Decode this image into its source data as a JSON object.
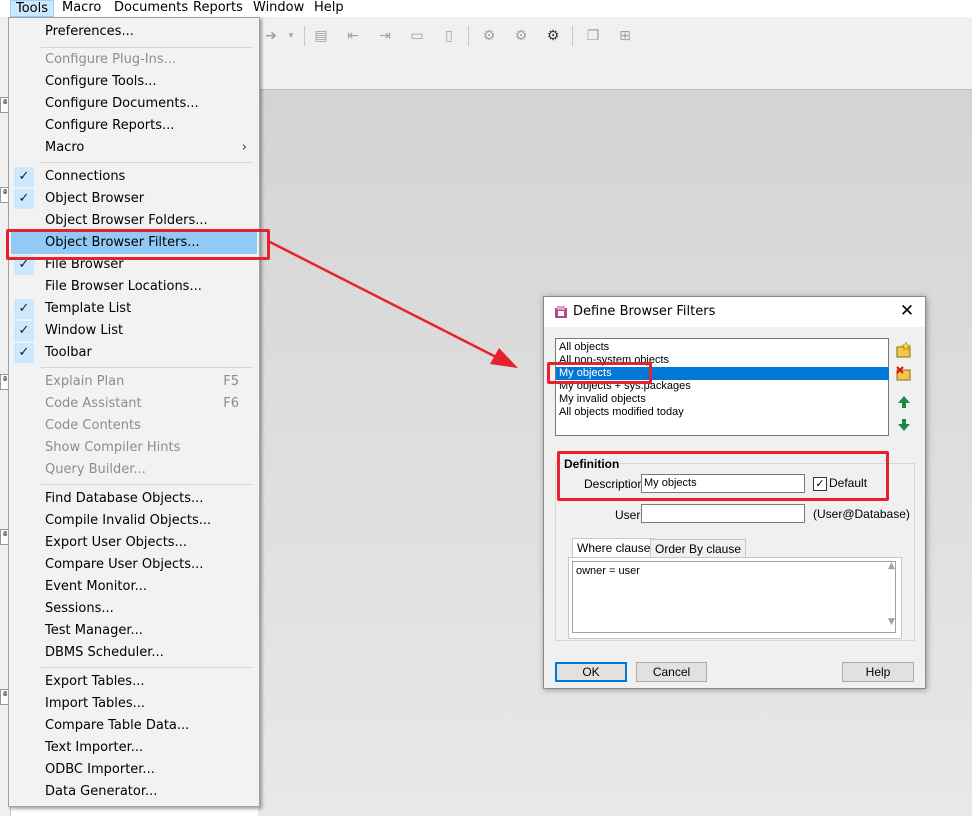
{
  "menubar": {
    "items": [
      {
        "label": "Tools",
        "active": true
      },
      {
        "label": "Macro"
      },
      {
        "label": "Documents"
      },
      {
        "label": "Reports"
      },
      {
        "label": "Window"
      },
      {
        "label": "Help"
      }
    ]
  },
  "background": {
    "strip_marks": [
      "ª",
      "ª",
      "ª",
      "ª",
      "ª"
    ]
  },
  "tools_menu": {
    "preferences": "Preferences...",
    "configure_plugins": "Configure Plug-Ins...",
    "configure_tools": "Configure Tools...",
    "configure_documents": "Configure Documents...",
    "configure_reports": "Configure Reports...",
    "macro": "Macro",
    "macro_arrow": "›",
    "connections": "Connections",
    "object_browser": "Object Browser",
    "object_browser_folders": "Object Browser Folders...",
    "object_browser_filters": "Object Browser Filters...",
    "file_browser": "File Browser",
    "file_browser_locations": "File Browser Locations...",
    "template_list": "Template List",
    "window_list": "Window List",
    "toolbar": "Toolbar",
    "explain_plan": "Explain Plan",
    "explain_plan_shortcut": "F5",
    "code_assistant": "Code Assistant",
    "code_assistant_shortcut": "F6",
    "code_contents": "Code Contents",
    "show_compiler_hints": "Show Compiler Hints",
    "query_builder": "Query Builder...",
    "find_database_objects": "Find Database Objects...",
    "compile_invalid_objects": "Compile Invalid Objects...",
    "export_user_objects": "Export User Objects...",
    "compare_user_objects": "Compare User Objects...",
    "event_monitor": "Event Monitor...",
    "sessions": "Sessions...",
    "test_manager": "Test Manager...",
    "dbms_scheduler": "DBMS Scheduler...",
    "export_tables": "Export Tables...",
    "import_tables": "Import Tables...",
    "compare_table_data": "Compare Table Data...",
    "text_importer": "Text Importer...",
    "odbc_importer": "ODBC Importer...",
    "data_generator": "Data Generator...",
    "check_glyph": "✓"
  },
  "dialog": {
    "title": "Define Browser Filters",
    "close_glyph": "✕",
    "filters": [
      "All objects",
      "All non-system objects",
      "My objects",
      "My objects + sys.packages",
      "My invalid objects",
      "All objects modified today"
    ],
    "selected_filter_index": 2,
    "definition_label": "Definition",
    "description_label": "Description",
    "description_value": "My objects",
    "default_label": "Default",
    "default_checked": true,
    "default_check_glyph": "✓",
    "user_label": "User",
    "user_value": "",
    "user_hint": "(User@Database)",
    "tab_where": "Where clause",
    "tab_order_by": "Order By clause",
    "clause_text": "owner = user",
    "ok_button": "OK",
    "cancel_button": "Cancel",
    "help_button": "Help"
  },
  "colors": {
    "highlight_red": "#e8222c",
    "menu_highlight": "#91c9f7",
    "list_selection": "#0078d7"
  }
}
